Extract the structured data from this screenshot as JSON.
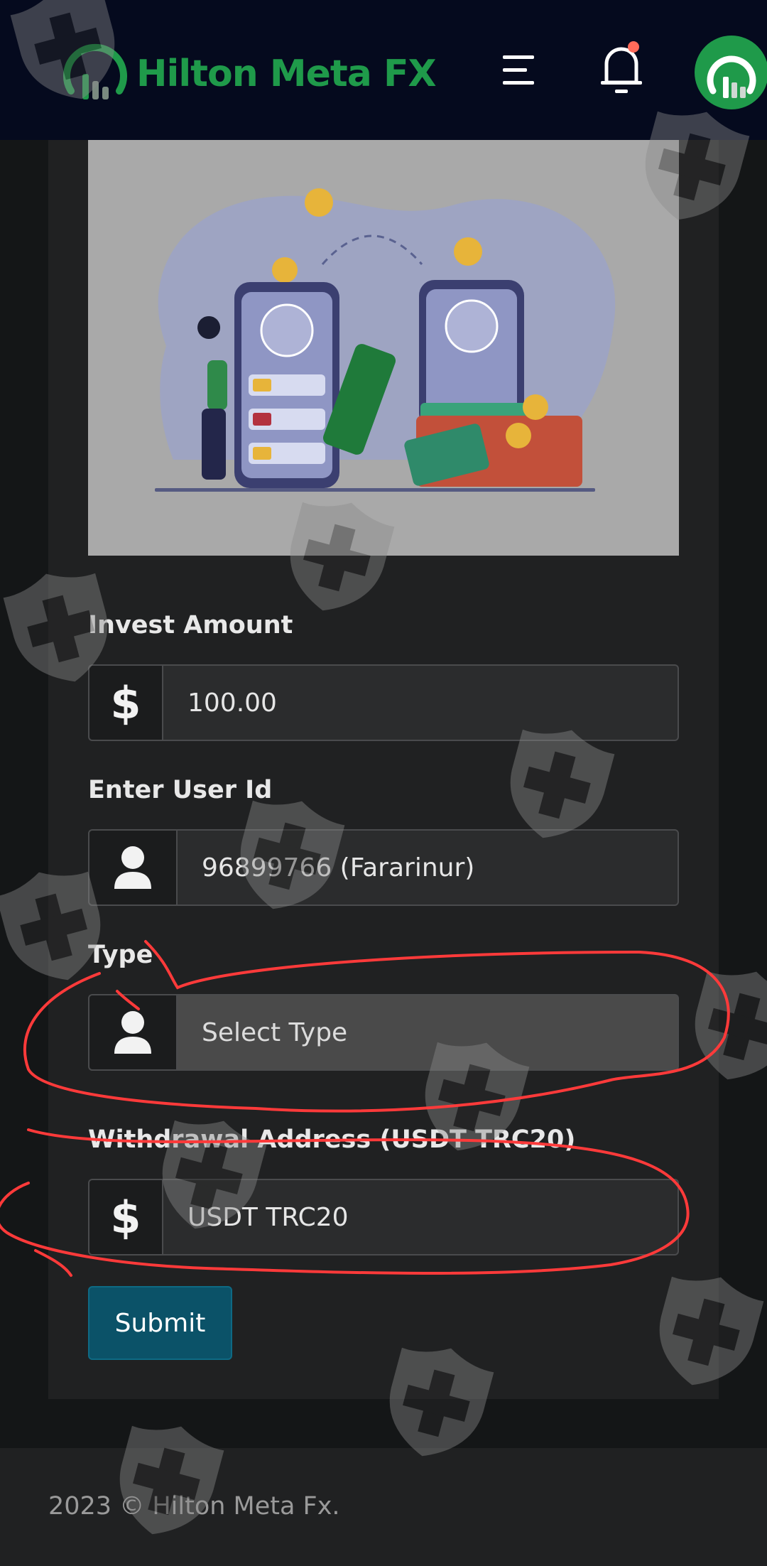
{
  "header": {
    "brand_name": "Hilton Meta FX",
    "icons": [
      "brand-logo-icon",
      "hamburger-menu-icon",
      "bell-icon",
      "avatar-icon"
    ],
    "notification_dot": true,
    "brand_color": "#1f9a4a"
  },
  "hero": {
    "illustration": "mobile-money-transfer-illustration"
  },
  "form": {
    "invest_amount": {
      "label": "Invest Amount",
      "value": "100.00",
      "icon": "dollar-icon"
    },
    "user_id": {
      "label": "Enter User Id",
      "value": "96899766 (Fararinur)",
      "icon": "user-icon"
    },
    "type": {
      "label": "Type",
      "selected": "Select Type",
      "icon": "user-icon"
    },
    "withdrawal_address": {
      "label": "Withdrawal Address (USDT TRC20)",
      "value": "USDT TRC20",
      "icon": "dollar-icon"
    },
    "submit_label": "Submit"
  },
  "footer": {
    "text": "2023 © Hilton Meta Fx."
  },
  "colors": {
    "header_bg": "#050a1e",
    "page_bg": "#141617",
    "card_bg": "#202122",
    "submit_bg": "#0b5268",
    "annotation_red": "#ff3a3a"
  }
}
